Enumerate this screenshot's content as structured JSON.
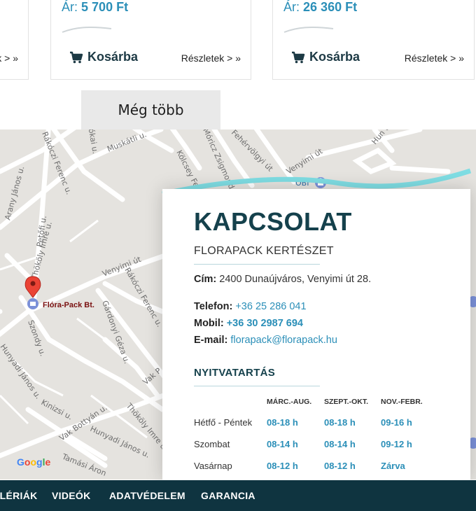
{
  "products": [
    {
      "details_label": "Részletek > »"
    },
    {
      "price_label": "Ár:",
      "price_value": "5 700 Ft",
      "cart_label": "Kosárba",
      "details_label": "Részletek > »"
    },
    {
      "price_label": "Ár:",
      "price_value": "26 360 Ft",
      "cart_label": "Kosárba",
      "details_label": "Részletek > »"
    }
  ],
  "more_button": "Még több",
  "map": {
    "marker_label": "Flóra-Pack Bt.",
    "poi_label": "OBI",
    "google_logo": "Google",
    "streets": [
      "Rákóczi Ferenc u.",
      "Muskátli u.",
      "Kölcsey Ferenc",
      "Móricz Zsigmond",
      "Venyimi út",
      "Hun u.",
      "Jókai u.",
      "Arany János u.",
      "Petőfi u.",
      "Fehérvölgyi út",
      "Venyimi út",
      "Rákóczi Ferenc u.",
      "Gárdonyi Géza u.",
      "Szondy u.",
      "Thököly Imre u.",
      "Kinizsi u.",
      "Vak Bottyán u.",
      "Hunyadi János u.",
      "Hunyadi János u.",
      "Thököly Imre u.",
      "Tamási Áron",
      "Vak P"
    ]
  },
  "contact": {
    "title": "KAPCSOLAT",
    "subtitle": "FLORAPACK KERTÉSZET",
    "address_label": "Cím:",
    "address_value": "2400 Dunaújváros, Venyimi út 28.",
    "phone_label": "Telefon:",
    "phone_value": "+36 25 286 041",
    "mobile_label": "Mobil:",
    "mobile_value": "+36 30 2987 694",
    "email_label": "E-mail:",
    "email_value": "florapack@florapack.hu",
    "hours_title": "NYITVATARTÁS",
    "columns": [
      "MÁRC.-AUG.",
      "SZEPT.-OKT.",
      "NOV.-FEBR."
    ],
    "rows": [
      {
        "day": "Hétfő - Péntek",
        "values": [
          "08-18 h",
          "08-18 h",
          "09-16 h"
        ]
      },
      {
        "day": "Szombat",
        "values": [
          "08-14 h",
          "08-14 h",
          "09-12 h"
        ]
      },
      {
        "day": "Vasárnap",
        "values": [
          "08-12 h",
          "08-12 h",
          "Zárva"
        ]
      }
    ]
  },
  "footer_nav": [
    "GALÉRIÁK",
    "VIDEÓK",
    "ADATVÉDELEM",
    "GARANCIA"
  ],
  "colors": {
    "accent": "#2b8fb8",
    "dark": "#0f3440",
    "title": "#15414c",
    "wave": "#7fdde3",
    "map_bg": "#e5e3df"
  }
}
